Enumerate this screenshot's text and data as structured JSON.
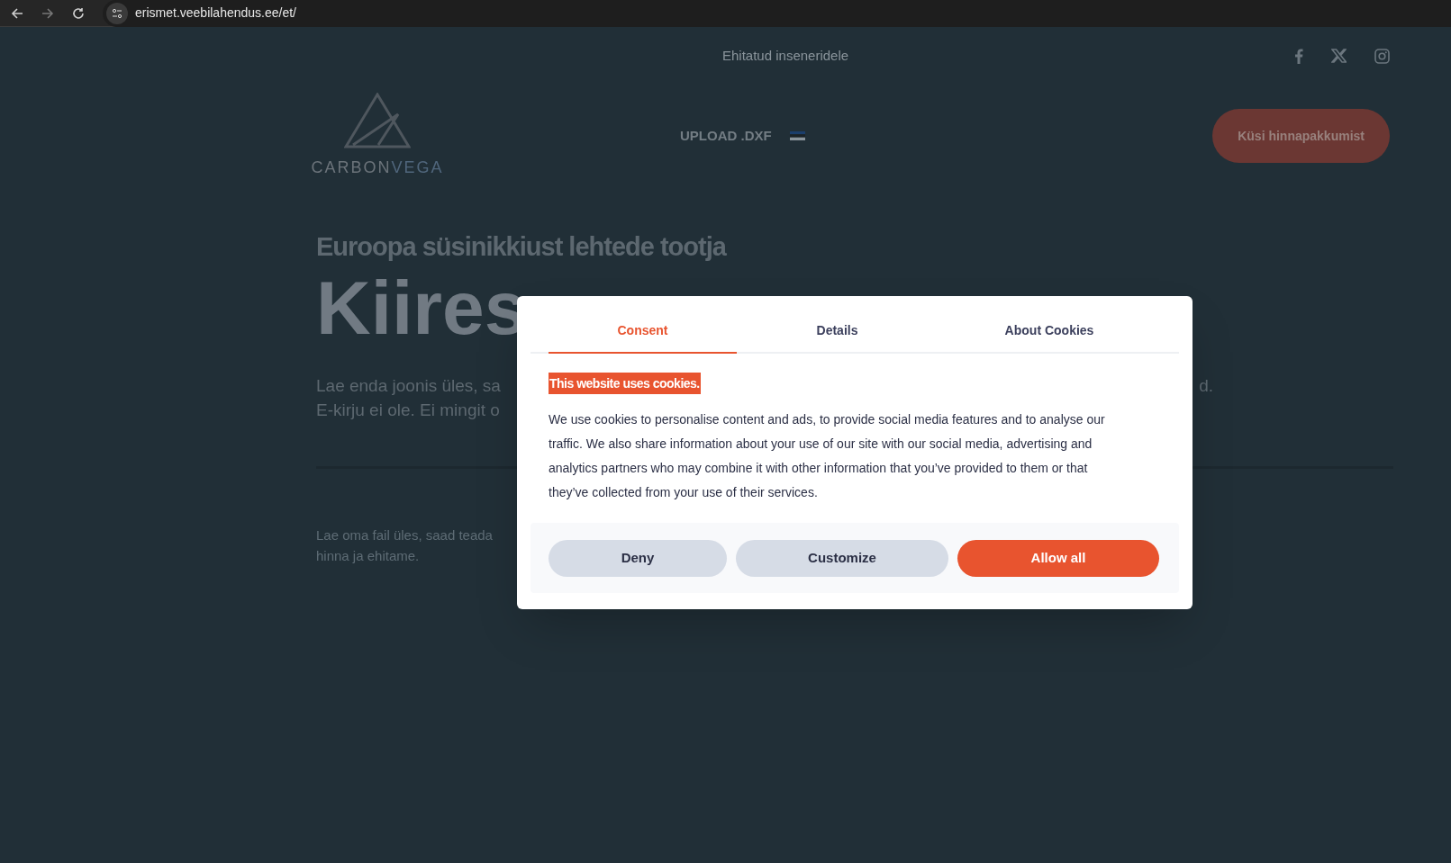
{
  "browser": {
    "url": "erismet.veebilahendus.ee/et/"
  },
  "topbar": {
    "tagline": "Ehitatud inseneridele",
    "social": [
      {
        "kind": "facebook"
      },
      {
        "kind": "x"
      },
      {
        "kind": "instagram"
      }
    ]
  },
  "header": {
    "logo": {
      "part1": "CARBON",
      "part2": "VEGA"
    },
    "nav": [
      {
        "label": "UPLOAD .DXF"
      }
    ],
    "cta": "Küsi hinnapakkumist"
  },
  "hero": {
    "kicker": "Euroopa süsinikkiust lehtede tootja",
    "title": "Kiires",
    "lines": [
      {
        "left": "Lae enda joonis üles, sa",
        "right": "d."
      },
      {
        "left": "E-kirju ei ole. Ei mingit o"
      }
    ],
    "note": "Lae oma fail üles, saad teada hinna ja ehitame."
  },
  "cookie_dialog": {
    "tabs": [
      {
        "label": "Consent",
        "selected": true
      },
      {
        "label": "Details",
        "selected": false
      },
      {
        "label": "About Cookies",
        "selected": false
      }
    ],
    "heading": "This website uses cookies.",
    "body": "We use cookies to personalise content and ads, to provide social media features and to analyse our traffic. We also share information about your use of our site with our social media, advertising and analytics partners who may combine it with other information that you’ve provided to them or that they’ve collected from your use of their services.",
    "buttons": [
      {
        "label": "Deny",
        "kind": "secondary"
      },
      {
        "label": "Customize",
        "kind": "secondary"
      },
      {
        "label": "Allow all",
        "kind": "primary"
      }
    ]
  }
}
